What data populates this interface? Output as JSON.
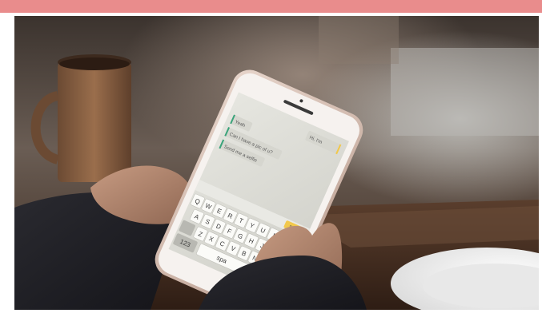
{
  "scene": {
    "description_free": true
  },
  "phone": {
    "messages": [
      {
        "text": "Hi, I'm",
        "side": "right"
      },
      {
        "text": "Yeah",
        "side": "left"
      },
      {
        "text": "Can I have a pic of u?",
        "side": "left"
      },
      {
        "text": "Send me a selfie",
        "side": "left"
      }
    ],
    "send_label": "Send",
    "keyboard_rows": [
      [
        "Q",
        "W",
        "E",
        "R",
        "T",
        "Y",
        "U",
        "I",
        "O",
        "P"
      ],
      [
        "A",
        "S",
        "D",
        "F",
        "G",
        "H",
        "J",
        "K",
        "L"
      ],
      [
        "Z",
        "X",
        "C",
        "V",
        "B",
        "N",
        "M"
      ]
    ],
    "numbers_key": "123",
    "space_key": "spa"
  },
  "colors": {
    "frame": "#e98c8c",
    "send_button": "#f2c84b",
    "accent_bar": "#3aa37a"
  }
}
